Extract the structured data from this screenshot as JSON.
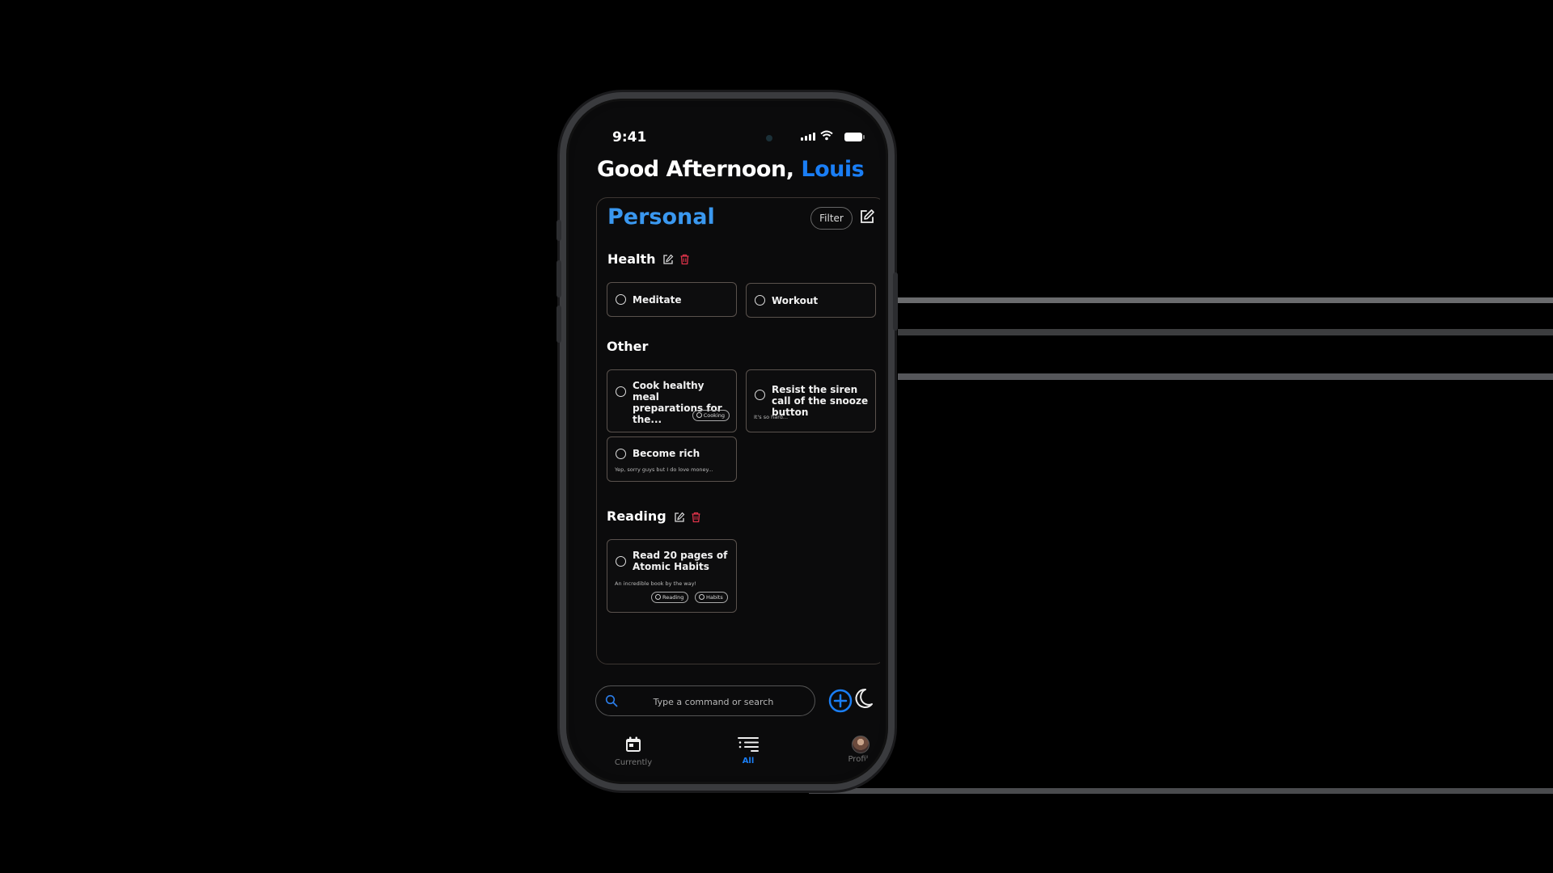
{
  "status_bar": {
    "time": "9:41"
  },
  "greeting": {
    "prefix": "Good Afternoon,",
    "name": "Louis"
  },
  "panel": {
    "title": "Personal",
    "filter_label": "Filter"
  },
  "groups": [
    {
      "title": "Health",
      "tasks": [
        {
          "title": "Meditate"
        },
        {
          "title": "Workout"
        }
      ]
    },
    {
      "title": "Other",
      "tasks": [
        {
          "title": "Cook healthy meal preparations for the...",
          "tags": [
            "Cooking"
          ]
        },
        {
          "title": "Resist the siren call of the snooze button",
          "note": "It's so hard..."
        },
        {
          "title": "Become rich",
          "note": "Yep, sorry guys but I do love money..."
        }
      ]
    },
    {
      "title": "Reading",
      "tasks": [
        {
          "title": "Read 20 pages of Atomic Habits",
          "note": "An incredible book by the way!",
          "tags": [
            "Reading",
            "Habits"
          ]
        }
      ]
    }
  ],
  "search": {
    "placeholder": "Type a command or search"
  },
  "tabs": [
    {
      "label": "Currently",
      "icon": "calendar-icon"
    },
    {
      "label": "All",
      "icon": "list-icon",
      "active": true
    },
    {
      "label": "Profile",
      "icon": "avatar"
    }
  ],
  "colors": {
    "accent": "#1a7ef5",
    "title_blue": "#3a98f0",
    "delete_red": "#e0334a"
  }
}
